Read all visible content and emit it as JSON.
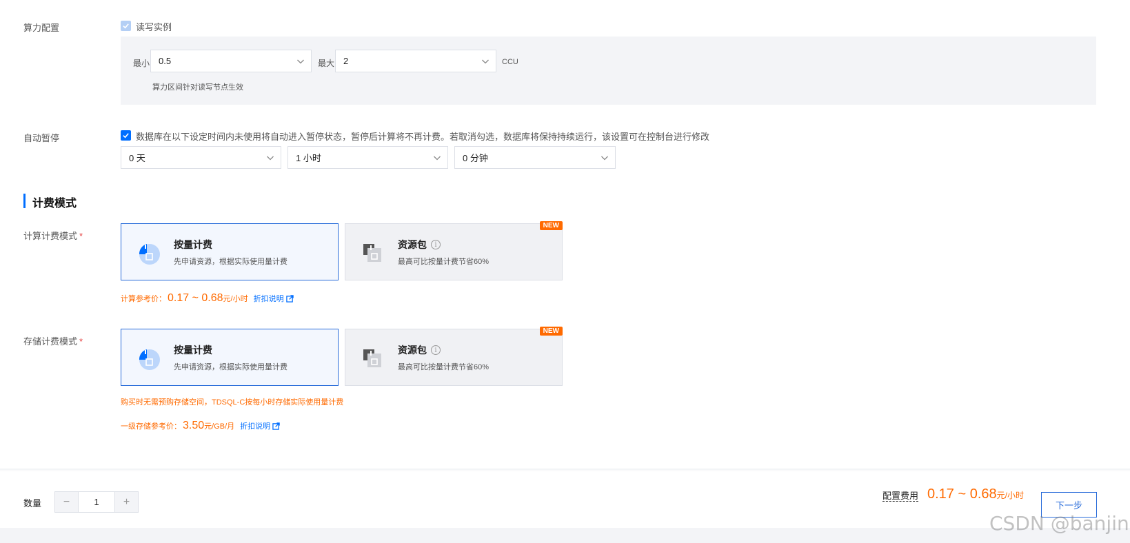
{
  "compute": {
    "label": "算力配置",
    "rw_checkbox_label": "读写实例",
    "min_label": "最小",
    "min_value": "0.5",
    "max_label": "最大",
    "max_value": "2",
    "unit": "CCU",
    "hint": "算力区间针对读写节点生效"
  },
  "auto_pause": {
    "label": "自动暂停",
    "checkbox_label": "数据库在以下设定时间内未使用将自动进入暂停状态，暂停后计算将不再计费。若取消勾选，数据库将保持持续运行，该设置可在控制台进行修改",
    "days": "0 天",
    "hours": "1 小时",
    "minutes": "0 分钟"
  },
  "billing": {
    "section_title": "计费模式",
    "compute_label": "计算计费模式",
    "storage_label": "存储计费模式",
    "required_mark": "*",
    "pay_as_you_go": {
      "title": "按量计费",
      "desc": "先申请资源，根据实际使用量计费"
    },
    "resource_pack": {
      "title": "资源包",
      "desc": "最高可比按量计费节省60%",
      "tag": "NEW",
      "info_icon": "i"
    },
    "compute_price": {
      "label": "计算参考价：",
      "value": "0.17 ~ 0.68",
      "unit": "元/小时"
    },
    "storage_note": "购买时无需预购存储空间，TDSQL-C按每小时存储实际使用量计费",
    "storage_price": {
      "label": "一级存储参考价：",
      "value": "3.50",
      "unit": "元/GB/月"
    },
    "discount_link": "折扣说明"
  },
  "footer": {
    "qty_label": "数量",
    "qty_minus": "−",
    "qty_value": "1",
    "qty_plus": "+",
    "fee_label": "配置费用",
    "fee_value": "0.17 ~ 0.68",
    "fee_unit": "元/小时",
    "next_button": "下一步",
    "watermark": "CSDN @banjin"
  },
  "colors": {
    "accent": "#006eff",
    "price": "#ff6a00",
    "panel_bg": "#f3f4f7",
    "card_active_border": "#2469d9"
  }
}
